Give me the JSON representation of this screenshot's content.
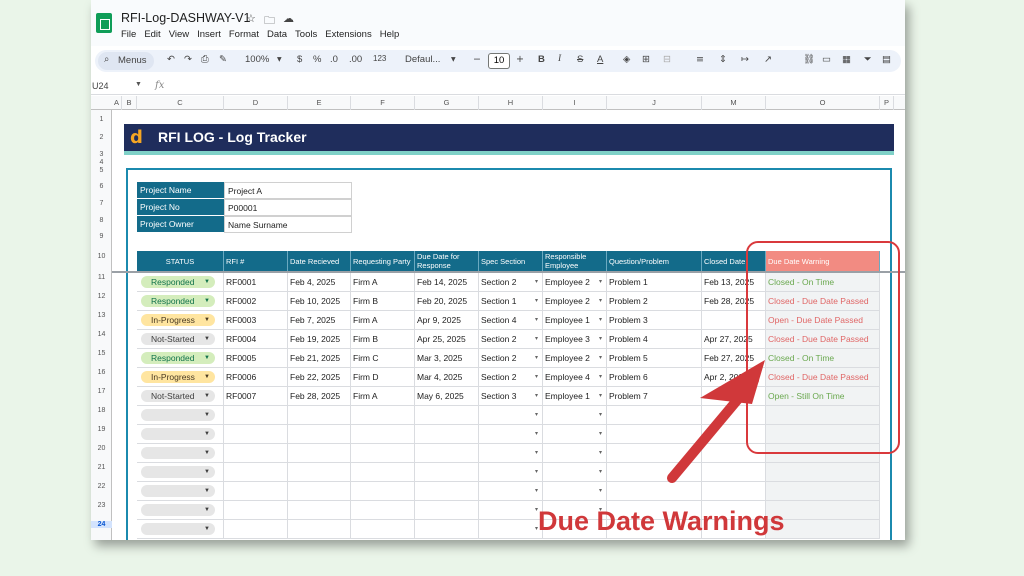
{
  "doc": {
    "title": "RFI-Log-DASHWAY-V1",
    "menus": [
      "File",
      "Edit",
      "View",
      "Insert",
      "Format",
      "Data",
      "Tools",
      "Extensions",
      "Help"
    ]
  },
  "toolbar": {
    "menus_label": "Menus",
    "zoom": "100%",
    "currency": "$",
    "percent": "%",
    "dec_decrease": ".0",
    "dec_increase": ".00",
    "number_format": "123",
    "font": "Defaul...",
    "font_size": "10",
    "bold": "B",
    "italic": "I",
    "strike": "S",
    "text_color": "A"
  },
  "formula_bar": {
    "cell_ref": "U24",
    "fx": "fx"
  },
  "columns": [
    "A",
    "B",
    "C",
    "D",
    "E",
    "F",
    "G",
    "H",
    "I",
    "J",
    "M",
    "O",
    "P"
  ],
  "rows": [
    "1",
    "2",
    "3",
    "4",
    "5",
    "6",
    "7",
    "8",
    "9",
    "10",
    "11",
    "12",
    "13",
    "14",
    "15",
    "16",
    "17",
    "18",
    "19",
    "20",
    "21",
    "22",
    "23",
    "24"
  ],
  "banner": {
    "logo": "d",
    "title": "RFI LOG - Log Tracker"
  },
  "project_info": [
    {
      "label": "Project Name",
      "value": "Project A"
    },
    {
      "label": "Project No",
      "value": "P00001"
    },
    {
      "label": "Project Owner",
      "value": "Name Surname"
    }
  ],
  "table": {
    "headers": {
      "status": "STATUS",
      "rfi": "RFI #",
      "date_received": "Date Recieved",
      "requesting_party": "Requesting Party",
      "due_date": "Due Date for Response",
      "spec_section": "Spec Section",
      "responsible": "Responsible Employee",
      "question": "Question/Problem",
      "closed_date": "Closed Date",
      "warning": "Due Date Warning"
    },
    "rows": [
      {
        "status": "Responded",
        "rfi": "RF0001",
        "date_received": "Feb 4, 2025",
        "requesting_party": "Firm A",
        "due_date": "Feb 14, 2025",
        "spec_section": "Section 2",
        "responsible": "Employee 2",
        "question": "Problem 1",
        "closed_date": "Feb 13, 2025",
        "warning": "Closed - On Time"
      },
      {
        "status": "Responded",
        "rfi": "RF0002",
        "date_received": "Feb 10, 2025",
        "requesting_party": "Firm B",
        "due_date": "Feb 20, 2025",
        "spec_section": "Section 1",
        "responsible": "Employee 2",
        "question": "Problem 2",
        "closed_date": "Feb 28, 2025",
        "warning": "Closed - Due Date Passed"
      },
      {
        "status": "In-Progress",
        "rfi": "RF0003",
        "date_received": "Feb 7, 2025",
        "requesting_party": "Firm A",
        "due_date": "Apr 9, 2025",
        "spec_section": "Section 4",
        "responsible": "Employee 1",
        "question": "Problem 3",
        "closed_date": "",
        "warning": "Open - Due Date Passed"
      },
      {
        "status": "Not-Started",
        "rfi": "RF0004",
        "date_received": "Feb 19, 2025",
        "requesting_party": "Firm B",
        "due_date": "Apr 25, 2025",
        "spec_section": "Section 2",
        "responsible": "Employee 3",
        "question": "Problem 4",
        "closed_date": "Apr 27, 2025",
        "warning": "Closed - Due Date Passed"
      },
      {
        "status": "Responded",
        "rfi": "RF0005",
        "date_received": "Feb 21, 2025",
        "requesting_party": "Firm C",
        "due_date": "Mar 3, 2025",
        "spec_section": "Section 2",
        "responsible": "Employee 2",
        "question": "Problem 5",
        "closed_date": "Feb 27, 2025",
        "warning": "Closed - On Time"
      },
      {
        "status": "In-Progress",
        "rfi": "RF0006",
        "date_received": "Feb 22, 2025",
        "requesting_party": "Firm D",
        "due_date": "Mar 4, 2025",
        "spec_section": "Section 2",
        "responsible": "Employee 4",
        "question": "Problem 6",
        "closed_date": "Apr 2, 2025",
        "warning": "Closed - Due Date Passed"
      },
      {
        "status": "Not-Started",
        "rfi": "RF0007",
        "date_received": "Feb 28, 2025",
        "requesting_party": "Firm A",
        "due_date": "May 6, 2025",
        "spec_section": "Section 3",
        "responsible": "Employee 1",
        "question": "Problem 7",
        "closed_date": "",
        "warning": "Open  - Still On Time"
      }
    ],
    "empty_rows": 7
  },
  "colors": {
    "responded_bg": "#d4edbc",
    "responded_fg": "#11734b",
    "inprogress_bg": "#ffe5a0",
    "inprogress_fg": "#473821",
    "notstarted_bg": "#e6e6e6",
    "notstarted_fg": "#3d3d3d",
    "warning_ok": "#6aa84f",
    "warning_bad": "#e06666"
  },
  "annotation": {
    "text": "Due Date Warnings"
  }
}
